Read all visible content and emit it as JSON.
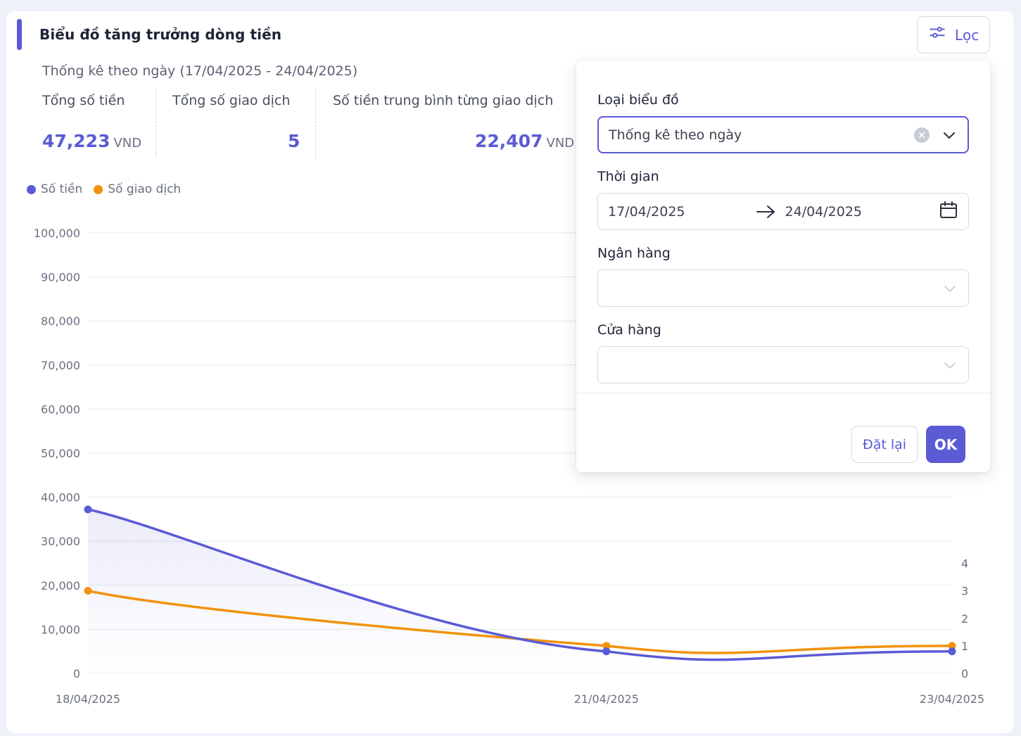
{
  "header": {
    "title": "Biểu đồ tăng trưởng dòng tiền",
    "filter_label": "Lọc",
    "subtitle": "Thống kê theo ngày (17/04/2025 - 24/04/2025)"
  },
  "stats": [
    {
      "label": "Tổng số tiền",
      "value": "47,223",
      "unit": "VND"
    },
    {
      "label": "Tổng số giao dịch",
      "value": "5",
      "unit": ""
    },
    {
      "label": "Số tiền trung bình từng giao dịch",
      "value": "22,407",
      "unit": "VND"
    }
  ],
  "colors": {
    "accent": "#5b5bd6",
    "series_amount": "#5b5bd6",
    "series_count": "#f2920c"
  },
  "chart_data": {
    "type": "line",
    "categories": [
      "18/04/2025",
      "21/04/2025",
      "23/04/2025"
    ],
    "x_ticks": [
      "18/04/2025",
      "21/04/2025",
      "23/04/2025"
    ],
    "series": [
      {
        "name": "Số tiền",
        "axis": "left",
        "values": [
          37223,
          5000,
          5000
        ]
      },
      {
        "name": "Số giao dịch",
        "axis": "right",
        "values": [
          3,
          1,
          1
        ]
      }
    ],
    "y_left_ticks": [
      "100,000",
      "90,000",
      "80,000",
      "70,000",
      "60,000",
      "50,000",
      "40,000",
      "30,000",
      "20,000",
      "10,000",
      "0"
    ],
    "y_right_ticks": [
      "4",
      "3",
      "2",
      "1",
      "0"
    ],
    "ylim_left": [
      0,
      100000
    ],
    "ylim_right": [
      0,
      16
    ],
    "grid": true,
    "legend_position": "top-left"
  },
  "filter_panel": {
    "chart_type_label": "Loại biểu đồ",
    "chart_type_value": "Thống kê theo ngày",
    "time_label": "Thời gian",
    "date_from": "17/04/2025",
    "date_to": "24/04/2025",
    "bank_label": "Ngân hàng",
    "bank_value": "",
    "store_label": "Cửa hàng",
    "store_value": "",
    "reset_label": "Đặt lại",
    "ok_label": "OK"
  }
}
